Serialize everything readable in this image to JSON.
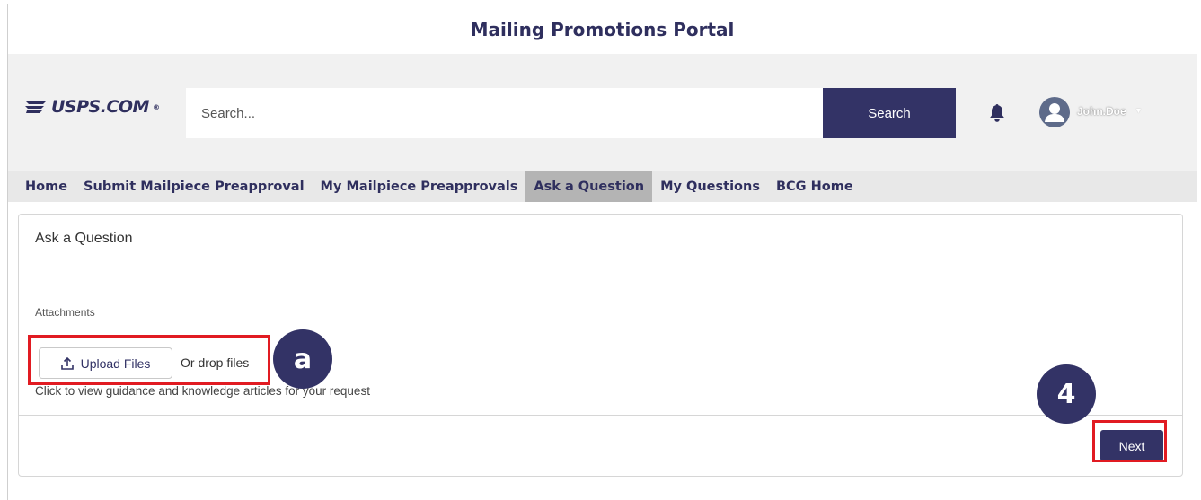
{
  "portal": {
    "title": "Mailing Promotions Portal"
  },
  "header": {
    "logo_text": "USPS.COM",
    "logo_mark": "®",
    "search_placeholder": "Search...",
    "search_button": "Search",
    "user_name": "John.Doe",
    "icons": {
      "notification": "bell-icon",
      "avatar": "user-avatar-icon",
      "dropdown": "chevron-down-icon"
    }
  },
  "nav": {
    "items": [
      {
        "label": "Home"
      },
      {
        "label": "Submit Mailpiece Preapproval"
      },
      {
        "label": "My Mailpiece Preapprovals"
      },
      {
        "label": "Ask a Question",
        "active": true
      },
      {
        "label": "My Questions"
      },
      {
        "label": "BCG Home"
      }
    ]
  },
  "form": {
    "title": "Ask a Question",
    "attachments_label": "Attachments",
    "upload_button": "Upload Files",
    "drop_text": "Or drop files",
    "guidance_text": "Click to view guidance and knowledge articles for your request",
    "next_button": "Next"
  },
  "callouts": {
    "upload": "a",
    "next": "4"
  },
  "colors": {
    "brand": "#333366",
    "highlight": "#e11b22",
    "header_bg": "#f1f1f1",
    "nav_active": "#b4b4b4"
  }
}
